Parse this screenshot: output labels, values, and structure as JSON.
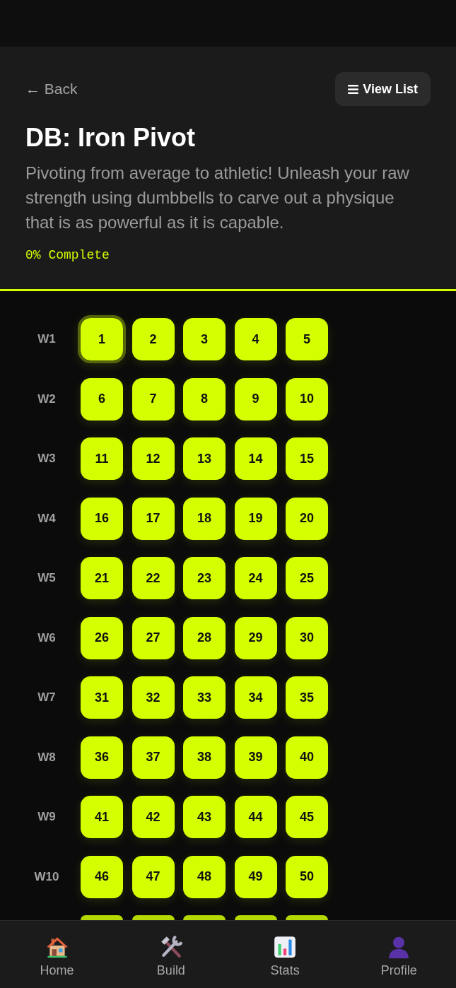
{
  "header": {
    "back": "← Back",
    "view_list": "View List",
    "title": "DB: Iron Pivot",
    "description": "Pivoting from average to athletic! Unleash your raw strength using dumbbells to carve out a physique that is as powerful as it is capable.",
    "progress": "0% Complete"
  },
  "weeks": [
    {
      "label": "W1",
      "days": [
        {
          "number": "1",
          "selected": true
        },
        {
          "number": "2",
          "selected": false
        },
        {
          "number": "3",
          "selected": false
        },
        {
          "number": "4",
          "selected": false
        },
        {
          "number": "5",
          "selected": false
        }
      ]
    },
    {
      "label": "W2",
      "days": [
        {
          "number": "6",
          "selected": false
        },
        {
          "number": "7",
          "selected": false
        },
        {
          "number": "8",
          "selected": false
        },
        {
          "number": "9",
          "selected": false
        },
        {
          "number": "10",
          "selected": false
        }
      ]
    },
    {
      "label": "W3",
      "days": [
        {
          "number": "11",
          "selected": false
        },
        {
          "number": "12",
          "selected": false
        },
        {
          "number": "13",
          "selected": false
        },
        {
          "number": "14",
          "selected": false
        },
        {
          "number": "15",
          "selected": false
        }
      ]
    },
    {
      "label": "W4",
      "days": [
        {
          "number": "16",
          "selected": false
        },
        {
          "number": "17",
          "selected": false
        },
        {
          "number": "18",
          "selected": false
        },
        {
          "number": "19",
          "selected": false
        },
        {
          "number": "20",
          "selected": false
        }
      ]
    },
    {
      "label": "W5",
      "days": [
        {
          "number": "21",
          "selected": false
        },
        {
          "number": "22",
          "selected": false
        },
        {
          "number": "23",
          "selected": false
        },
        {
          "number": "24",
          "selected": false
        },
        {
          "number": "25",
          "selected": false
        }
      ]
    },
    {
      "label": "W6",
      "days": [
        {
          "number": "26",
          "selected": false
        },
        {
          "number": "27",
          "selected": false
        },
        {
          "number": "28",
          "selected": false
        },
        {
          "number": "29",
          "selected": false
        },
        {
          "number": "30",
          "selected": false
        }
      ]
    },
    {
      "label": "W7",
      "days": [
        {
          "number": "31",
          "selected": false
        },
        {
          "number": "32",
          "selected": false
        },
        {
          "number": "33",
          "selected": false
        },
        {
          "number": "34",
          "selected": false
        },
        {
          "number": "35",
          "selected": false
        }
      ]
    },
    {
      "label": "W8",
      "days": [
        {
          "number": "36",
          "selected": false
        },
        {
          "number": "37",
          "selected": false
        },
        {
          "number": "38",
          "selected": false
        },
        {
          "number": "39",
          "selected": false
        },
        {
          "number": "40",
          "selected": false
        }
      ]
    },
    {
      "label": "W9",
      "days": [
        {
          "number": "41",
          "selected": false
        },
        {
          "number": "42",
          "selected": false
        },
        {
          "number": "43",
          "selected": false
        },
        {
          "number": "44",
          "selected": false
        },
        {
          "number": "45",
          "selected": false
        }
      ]
    },
    {
      "label": "W10",
      "days": [
        {
          "number": "46",
          "selected": false
        },
        {
          "number": "47",
          "selected": false
        },
        {
          "number": "48",
          "selected": false
        },
        {
          "number": "49",
          "selected": false
        },
        {
          "number": "50",
          "selected": false
        }
      ]
    }
  ],
  "partial_week": {
    "days": [
      {
        "selected": false
      },
      {
        "selected": false
      },
      {
        "selected": false
      },
      {
        "selected": false
      },
      {
        "selected": false
      }
    ]
  },
  "nav": [
    {
      "label": "Home"
    },
    {
      "label": "Build"
    },
    {
      "label": "Stats"
    },
    {
      "label": "Profile"
    }
  ]
}
